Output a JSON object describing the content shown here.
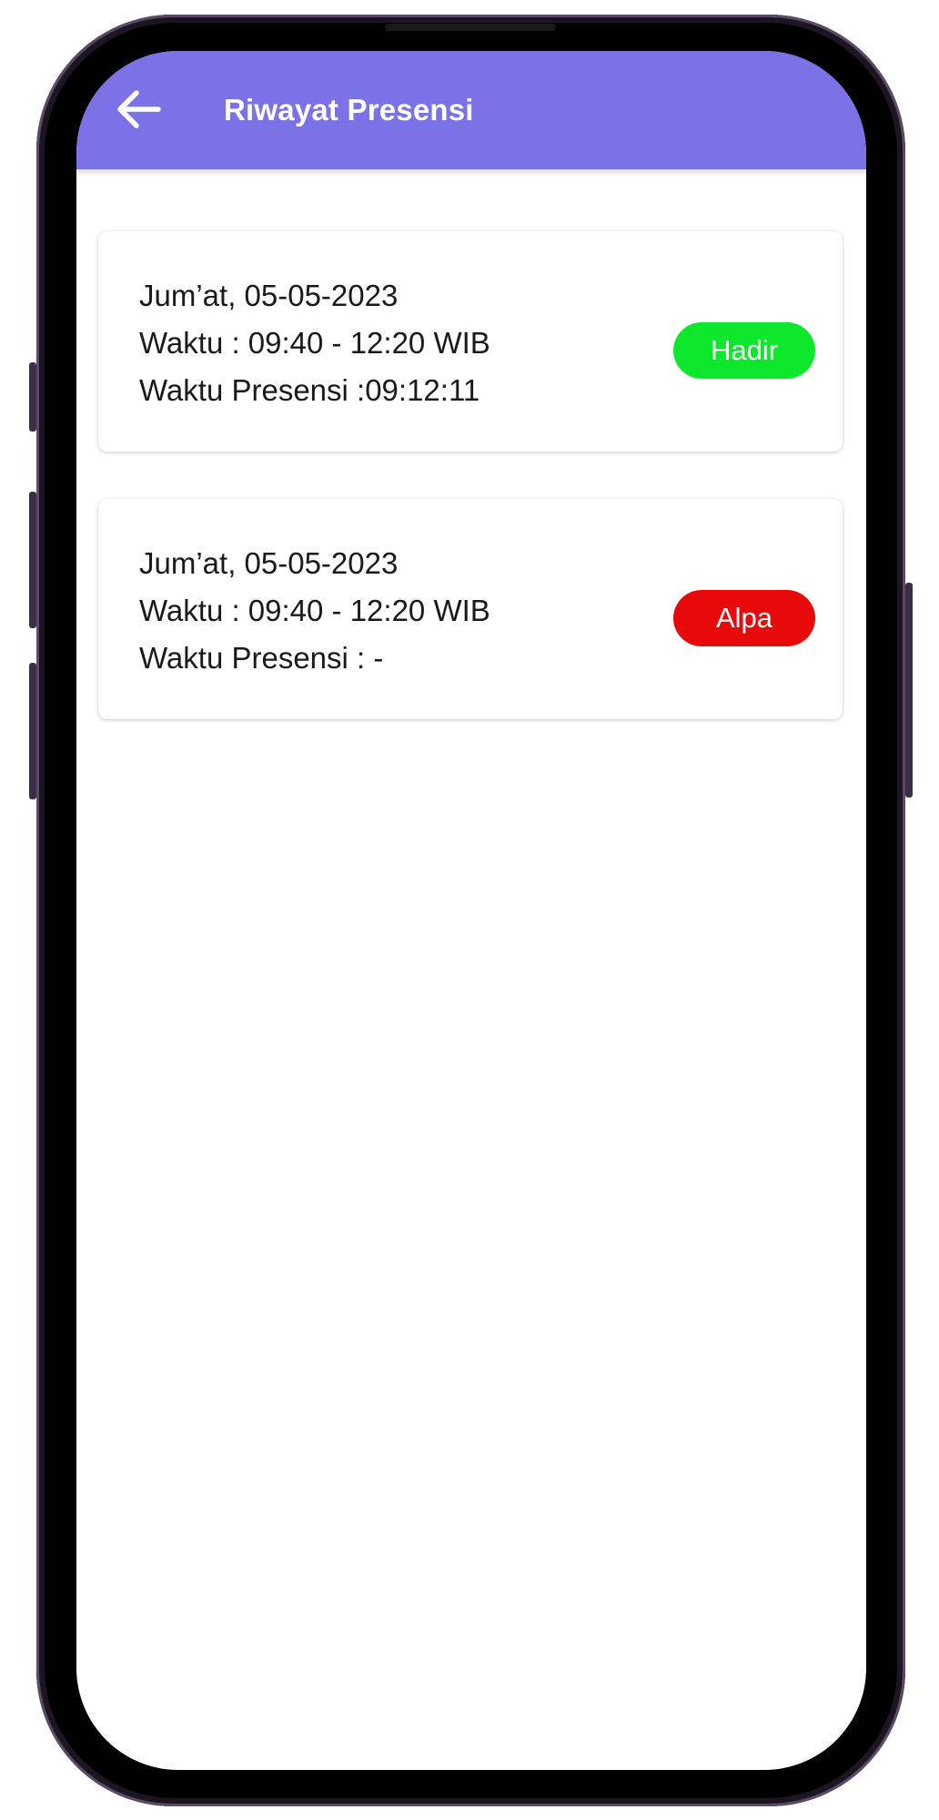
{
  "header": {
    "title": "Riwayat Presensi",
    "back_icon": "arrow-left-icon",
    "background_color": "#7b72e8"
  },
  "records": [
    {
      "date": "Jum’at, 05-05-2023",
      "time": "Waktu : 09:40 - 12:20 WIB",
      "presence_time": "Waktu Presensi :09:12:11",
      "status": "Hadir",
      "status_color": "#0ee82c"
    },
    {
      "date": "Jum’at, 05-05-2023",
      "time": "Waktu : 09:40 - 12:20 WIB",
      "presence_time": "Waktu Presensi : -",
      "status": "Alpa",
      "status_color": "#e80a0a"
    }
  ]
}
